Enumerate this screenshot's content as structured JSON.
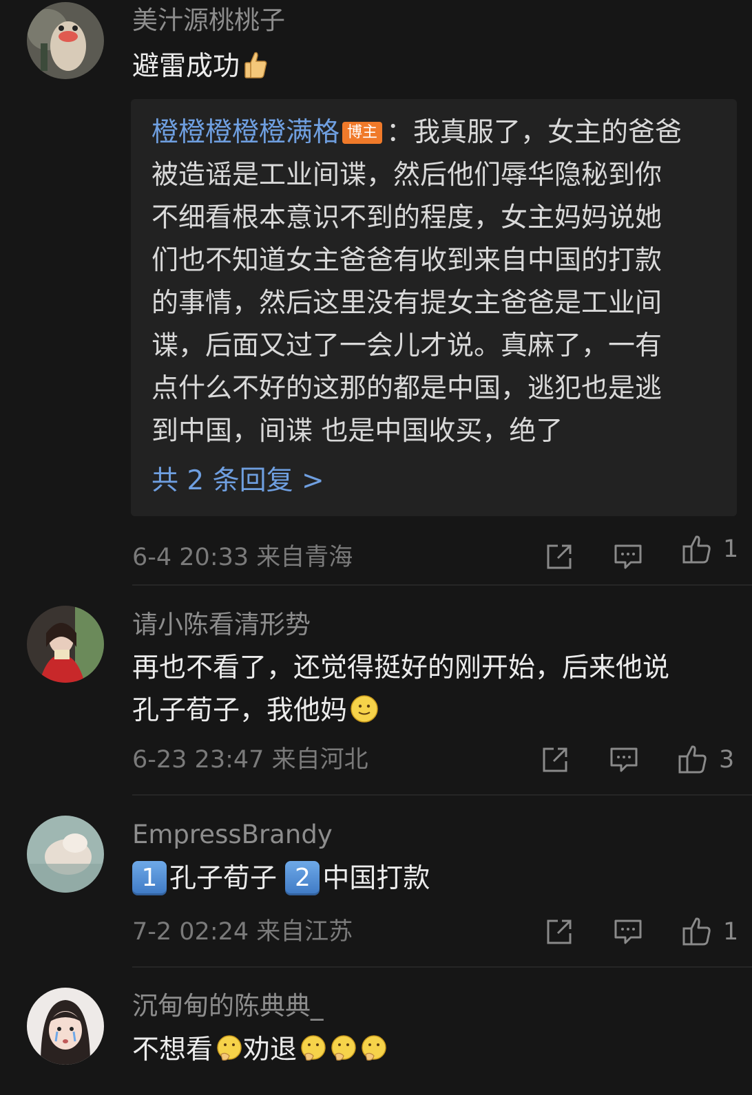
{
  "comments": [
    {
      "user": "美汁源桃桃子",
      "text": "避雷成功",
      "emoji": "thumbs-up-emoji",
      "reply": {
        "author": "橙橙橙橙橙满格",
        "badge": "博主",
        "lines": [
          "：我真服了，女主的爸爸",
          "被造谣是工业间谍，然后他们辱华隐秘到你",
          "不细看根本意识不到的程度，女主妈妈说她",
          "们也不知道女主爸爸有收到来自中国的打款",
          "的事情，然后这里没有提女主爸爸是工业间",
          "谍，后面又过了一会儿才说。真麻了，一有",
          "点什么不好的这那的都是中国，逃犯也是逃",
          "到中国，间谍 也是中国收买，绝了"
        ],
        "more": "共 2 条回复 >"
      },
      "time": "6-4 20:33",
      "location": "来自青海",
      "likes": "1"
    },
    {
      "user": "请小陈看清形势",
      "lines": [
        "再也不看了，还觉得挺好的刚开始，后来他说",
        "孔子荀子，我他妈"
      ],
      "emoji": "smile-emoji",
      "time": "6-23 23:47",
      "location": "来自河北",
      "likes": "3"
    },
    {
      "user": "EmpressBrandy",
      "key1": "1",
      "part1": "孔子荀子",
      "key2": "2",
      "part2": "中国打款",
      "time": "7-2 02:24",
      "location": "来自江苏",
      "likes": "1"
    },
    {
      "user": "沉甸甸的陈典典_",
      "part1": "不想看",
      "part2": "劝退",
      "emoji": "thinking-emoji"
    }
  ],
  "colors": {
    "background": "#161616",
    "link": "#6f9fe0",
    "badge": "#f07a2a"
  }
}
